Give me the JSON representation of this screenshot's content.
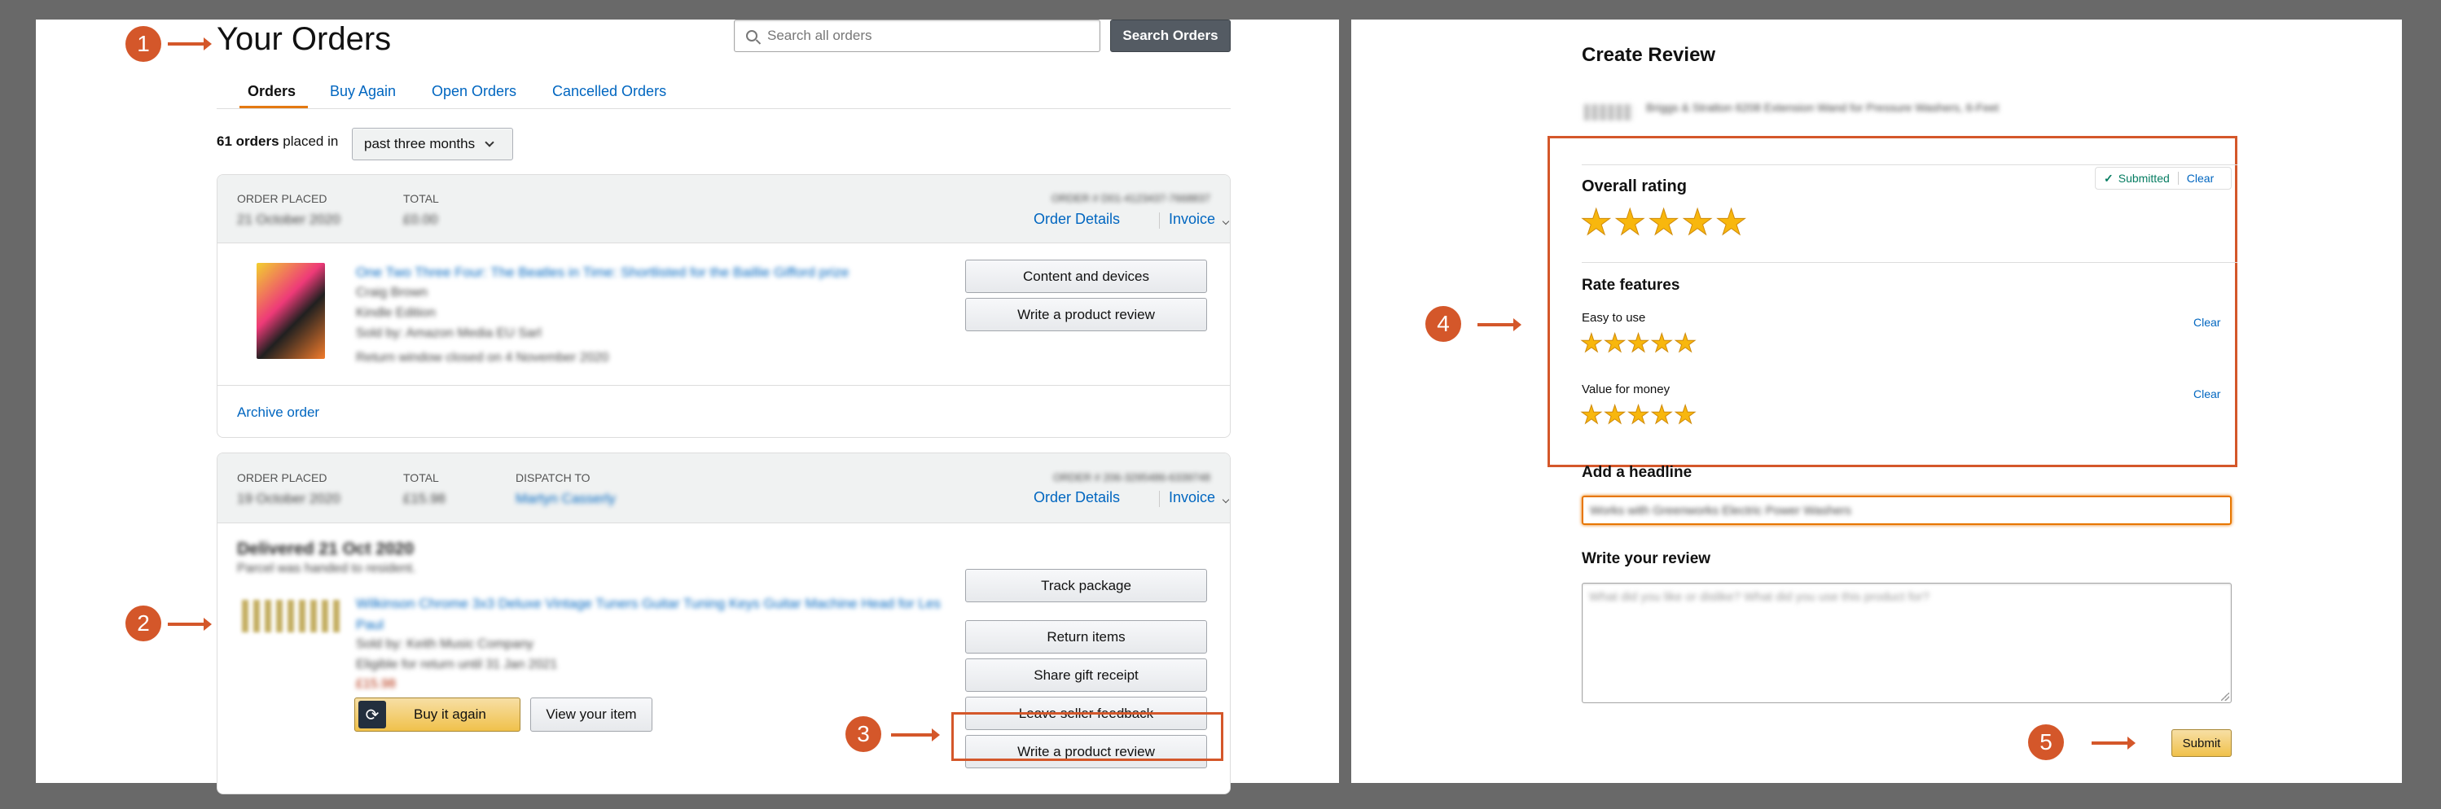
{
  "markers": [
    "1",
    "2",
    "3",
    "4",
    "5"
  ],
  "orders_page": {
    "title": "Your Orders",
    "search_placeholder": "Search all orders",
    "search_button": "Search Orders",
    "tabs": [
      "Orders",
      "Buy Again",
      "Open Orders",
      "Cancelled Orders"
    ],
    "orders_count": "61 orders",
    "placed_in_text": "placed in",
    "period_select": "past three months",
    "order1": {
      "placed_label": "ORDER PLACED",
      "placed_value": "21 October 2020",
      "total_label": "TOTAL",
      "total_value": "£0.00",
      "order_number": "ORDER # D01-4123437-7668837",
      "details_link": "Order Details",
      "invoice_link": "Invoice",
      "item_title": "One Two Three Four: The Beatles in Time: Shortlisted for the Baillie Gifford prize",
      "item_author": "Craig Brown",
      "item_format": "Kindle Edition",
      "item_seller": "Sold by: Amazon Media EU Sarl",
      "item_return": "Return window closed on 4 November 2020",
      "btn_content": "Content and devices",
      "btn_review": "Write a product review",
      "archive_link": "Archive order"
    },
    "order2": {
      "placed_label": "ORDER PLACED",
      "placed_value": "19 October 2020",
      "total_label": "TOTAL",
      "total_value": "£15.98",
      "dispatch_label": "DISPATCH TO",
      "dispatch_value": "Martyn Casserly",
      "order_number": "ORDER # 206-3295486-6339748",
      "details_link": "Order Details",
      "invoice_link": "Invoice",
      "delivered": "Delivered 21 Oct 2020",
      "delivered_note": "Parcel was handed to resident.",
      "item_title": "Wilkinson Chrome 3x3 Deluxe Vintage Tuners Guitar Tuning Keys Guitar Machine Head for Les Paul",
      "item_seller": "Sold by: Keith Music Company",
      "item_return": "Eligible for return until 31 Jan 2021",
      "item_price": "£15.98",
      "btn_buy_again": "Buy it again",
      "btn_view_item": "View your item",
      "btn_track": "Track package",
      "btn_return": "Return items",
      "btn_share": "Share gift receipt",
      "btn_feedback": "Leave seller feedback",
      "btn_review": "Write a product review"
    }
  },
  "review_page": {
    "title": "Create Review",
    "product_name": "Briggs & Stratton 6208 Extension Wand for Pressure Washers, 6-Feet",
    "overall_rating_label": "Overall rating",
    "overall_rating": 5,
    "submitted_text": "Submitted",
    "clear_text": "Clear",
    "rate_features_label": "Rate features",
    "features": [
      {
        "label": "Easy to use",
        "rating": 5,
        "clear": "Clear"
      },
      {
        "label": "Value for money",
        "rating": 5,
        "clear": "Clear"
      }
    ],
    "headline_label": "Add a headline",
    "headline_value": "Works with Greenworks Electric Power Washers",
    "review_label": "Write your review",
    "review_placeholder": "What did you like or dislike? What did you use this product for?",
    "submit_button": "Submit"
  },
  "colors": {
    "marker": "#d4572a",
    "link": "#0066c0",
    "star": "#f8b70d",
    "button_yellow": "#f0c14b",
    "tab_accent": "#e47911"
  }
}
